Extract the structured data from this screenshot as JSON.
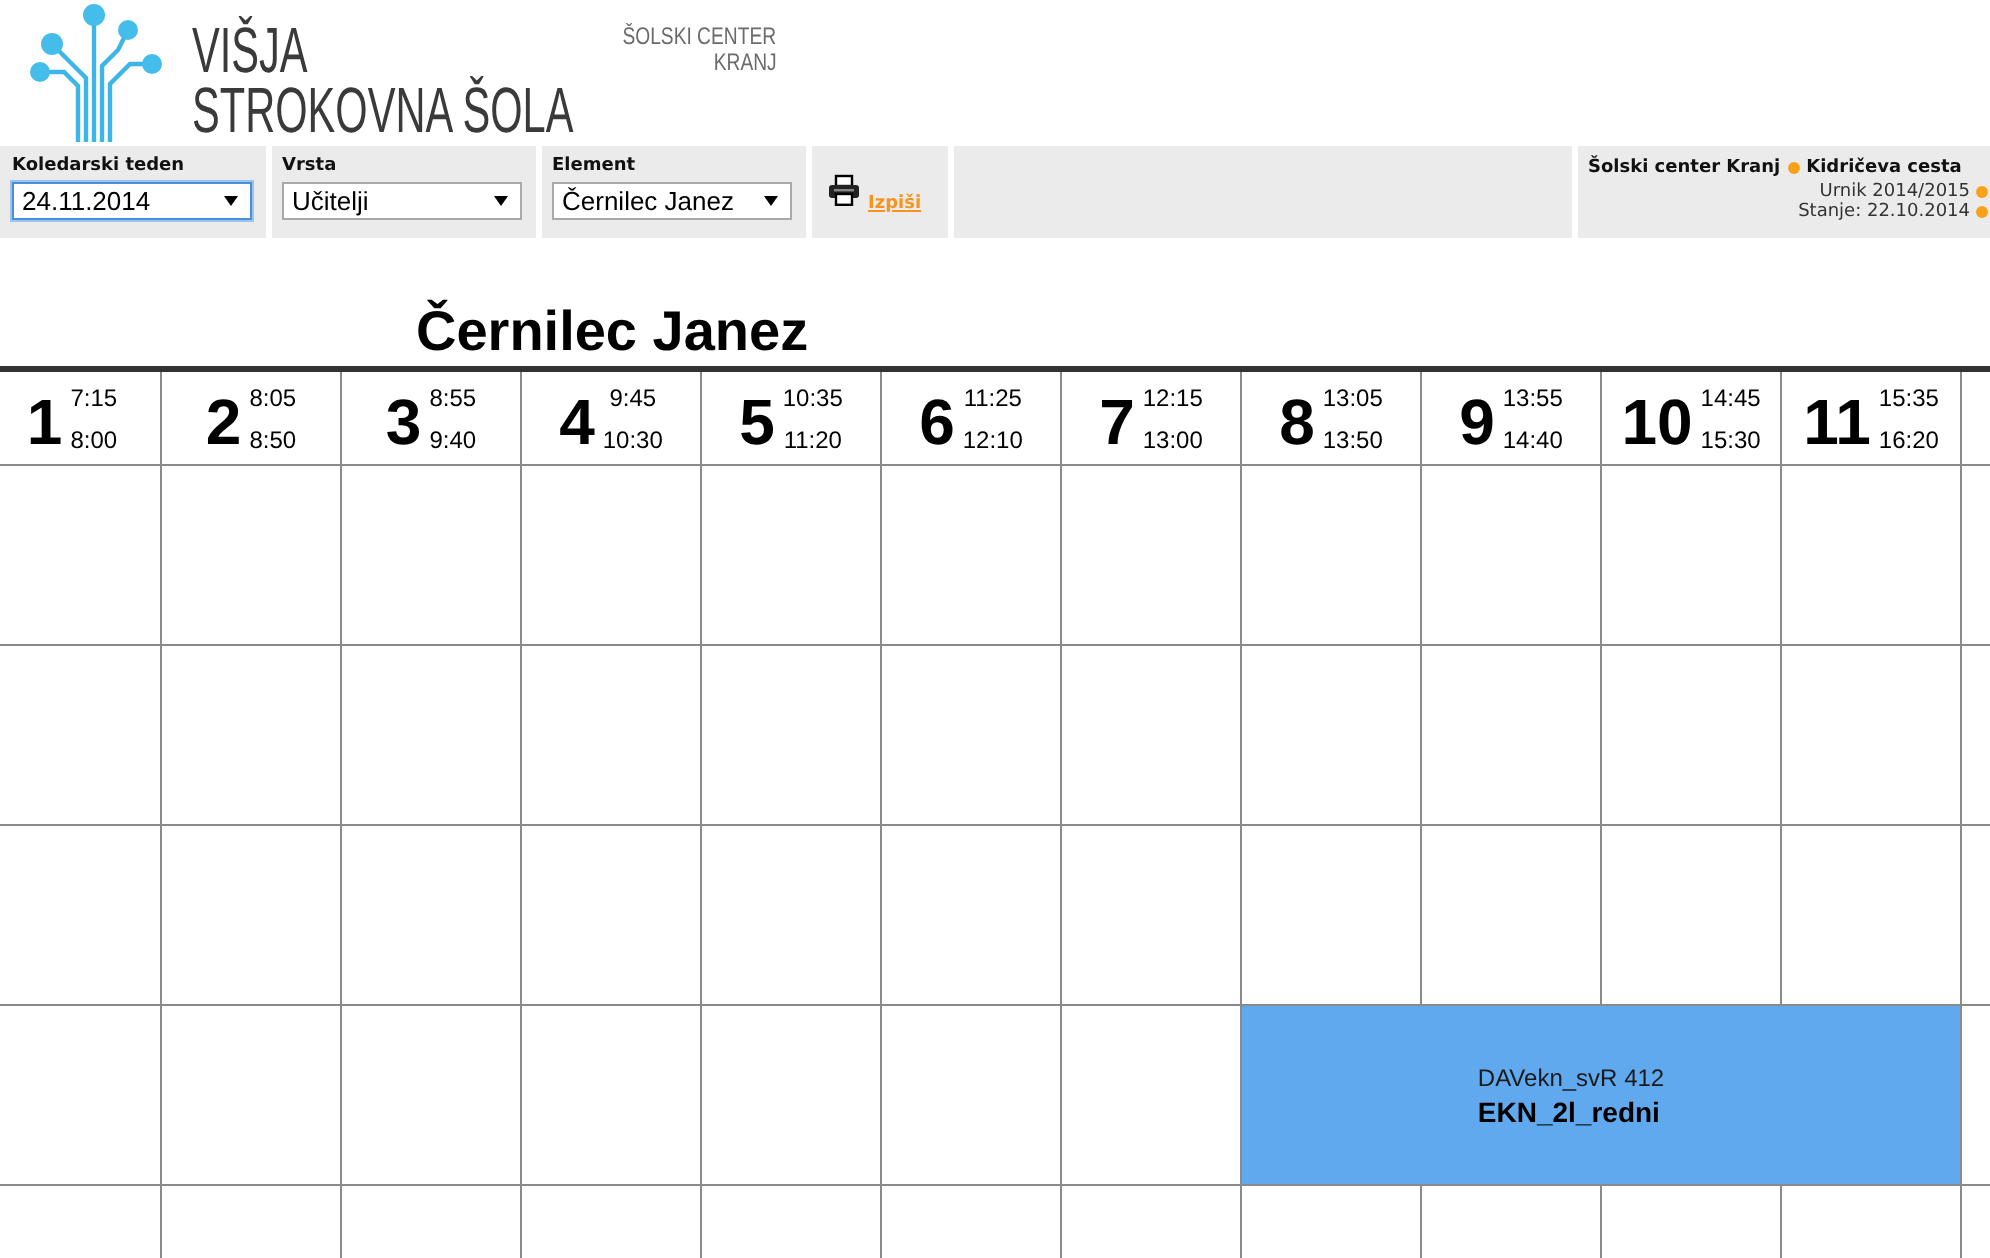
{
  "header": {
    "wordmark": [
      "VIŠJA",
      "STROKOVNA ŠOLA"
    ],
    "school": [
      "ŠOLSKI CENTER",
      "KRANJ"
    ]
  },
  "toolbar": {
    "filters": [
      {
        "label": "Koledarski teden",
        "value": "24.11.2014",
        "focused": true
      },
      {
        "label": "Vrsta",
        "value": "Učitelji",
        "focused": false
      },
      {
        "label": "Element",
        "value": "Černilec Janez",
        "focused": false
      }
    ],
    "print": {
      "label": "Izpiši"
    },
    "info": [
      {
        "kind": "heading",
        "parts": [
          "Šolski center Kranj",
          "Kidričeva cesta"
        ],
        "trailing_dot": false
      },
      {
        "kind": "detail",
        "parts": [
          "Urnik 2014/2015"
        ],
        "trailing_dot": true
      },
      {
        "kind": "detail",
        "parts": [
          "Stanje: 22.10.2014"
        ],
        "trailing_dot": true
      }
    ]
  },
  "timetable": {
    "title": "Černilec Janez",
    "periods": [
      {
        "number": "1",
        "start": "7:15",
        "end": "8:00"
      },
      {
        "number": "2",
        "start": "8:05",
        "end": "8:50"
      },
      {
        "number": "3",
        "start": "8:55",
        "end": "9:40"
      },
      {
        "number": "4",
        "start": "9:45",
        "end": "10:30"
      },
      {
        "number": "5",
        "start": "10:35",
        "end": "11:20"
      },
      {
        "number": "6",
        "start": "11:25",
        "end": "12:10"
      },
      {
        "number": "7",
        "start": "12:15",
        "end": "13:00"
      },
      {
        "number": "8",
        "start": "13:05",
        "end": "13:50"
      },
      {
        "number": "9",
        "start": "13:55",
        "end": "14:40"
      },
      {
        "number": "10",
        "start": "14:45",
        "end": "15:30"
      },
      {
        "number": "11",
        "start": "15:35",
        "end": "16:20"
      }
    ],
    "rows": [
      {
        "cells": [
          {
            "kind": "free"
          },
          {
            "kind": "free"
          },
          {
            "kind": "free"
          },
          {
            "kind": "free"
          },
          {
            "kind": "free"
          },
          {
            "kind": "free"
          },
          {
            "kind": "free"
          },
          {
            "kind": "free"
          },
          {
            "kind": "free"
          },
          {
            "kind": "free"
          },
          {
            "kind": "free"
          }
        ]
      },
      {
        "cells": [
          {
            "kind": "free"
          },
          {
            "kind": "free"
          },
          {
            "kind": "free"
          },
          {
            "kind": "free"
          },
          {
            "kind": "free"
          },
          {
            "kind": "free"
          },
          {
            "kind": "free"
          },
          {
            "kind": "free"
          },
          {
            "kind": "free"
          },
          {
            "kind": "free"
          },
          {
            "kind": "free"
          }
        ]
      },
      {
        "cells": [
          {
            "kind": "free"
          },
          {
            "kind": "free"
          },
          {
            "kind": "free"
          },
          {
            "kind": "free"
          },
          {
            "kind": "free"
          },
          {
            "kind": "free"
          },
          {
            "kind": "free"
          },
          {
            "kind": "free"
          },
          {
            "kind": "free"
          },
          {
            "kind": "free"
          },
          {
            "kind": "free"
          }
        ]
      },
      {
        "cells": [
          {
            "kind": "free"
          },
          {
            "kind": "free"
          },
          {
            "kind": "free"
          },
          {
            "kind": "free"
          },
          {
            "kind": "free"
          },
          {
            "kind": "free"
          },
          {
            "kind": "free"
          },
          {
            "kind": "lesson",
            "subject": "DAVekn_svR",
            "room": "412",
            "group": "EKN_2l_redni",
            "color": "#60a9ef"
          },
          {
            "kind": "continued"
          },
          {
            "kind": "continued"
          },
          {
            "kind": "continued"
          }
        ]
      },
      {
        "cells": [
          {
            "kind": "free"
          },
          {
            "kind": "free"
          },
          {
            "kind": "free"
          },
          {
            "kind": "free"
          },
          {
            "kind": "free"
          },
          {
            "kind": "free"
          },
          {
            "kind": "free"
          },
          {
            "kind": "free"
          },
          {
            "kind": "free"
          },
          {
            "kind": "free"
          },
          {
            "kind": "free"
          }
        ]
      }
    ]
  }
}
